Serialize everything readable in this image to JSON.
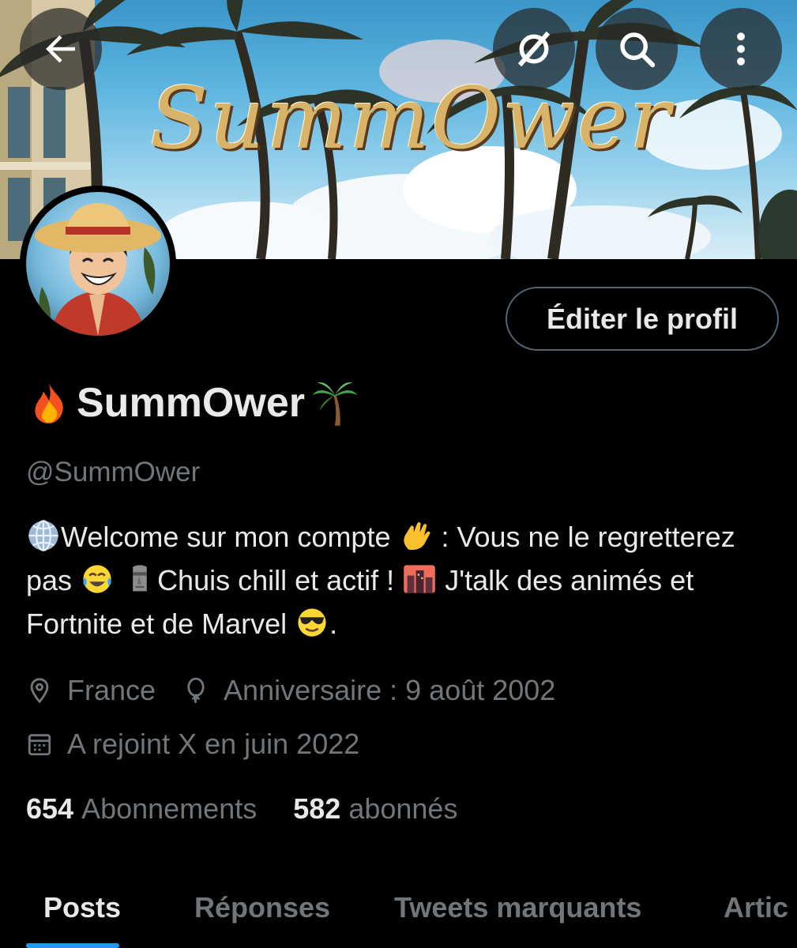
{
  "banner": {
    "text": "SummOwer"
  },
  "header": {
    "back_icon": "arrow-left-icon",
    "grok_icon": "grok-icon",
    "search_icon": "search-icon",
    "more_icon": "more-vertical-icon"
  },
  "profile": {
    "edit_label": "Éditer le profil",
    "display_name": "SummOwer",
    "handle": "@SummOwer",
    "bio_parts": {
      "p1": "Welcome sur mon compte ",
      "p2": " : Vous ne le regretterez pas ",
      "p3": "Chuis chill et actif ! ",
      "p4": " J'talk des animés et Fortnite et de Marvel ",
      "p5": "."
    },
    "location": "France",
    "birthday": "Anniversaire : 9 août 2002",
    "joined": "A rejoint X en juin 2022",
    "following_count": "654",
    "following_label": "Abonnements",
    "followers_count": "582",
    "followers_label": "abonnés"
  },
  "tabs": [
    {
      "label": "Posts",
      "active": true
    },
    {
      "label": "Réponses",
      "active": false
    },
    {
      "label": "Tweets marquants",
      "active": false
    },
    {
      "label": "Artic",
      "active": false
    }
  ],
  "colors": {
    "accent": "#1d9bf0",
    "background": "#000000",
    "text_primary": "#e7e9ea",
    "text_secondary": "#71767b"
  }
}
